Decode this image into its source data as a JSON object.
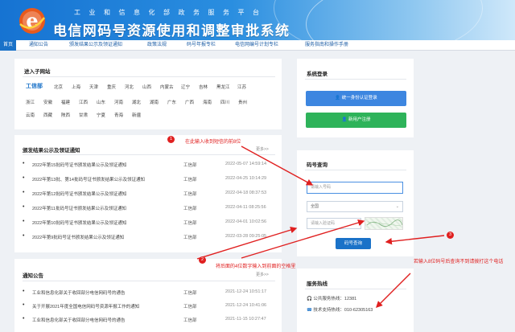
{
  "header": {
    "ministry": "工业和信息化部政务服务平台",
    "system_title": "电信网码号资源使用和调整审批系统"
  },
  "nav": [
    "首页",
    "通知公告",
    "颁发结果公示及领证通知",
    "政策法规",
    "码号年报专栏",
    "电信网编号计划专栏",
    "服务指南和操作手册"
  ],
  "subsites": {
    "title": "进入子网站",
    "items": [
      "工信部",
      "北京",
      "上海",
      "天津",
      "重庆",
      "河北",
      "山西",
      "内蒙古",
      "辽宁",
      "吉林",
      "黑龙江",
      "江苏",
      "浙江",
      "安徽",
      "福建",
      "江西",
      "山东",
      "河南",
      "湖北",
      "湖南",
      "广东",
      "广西",
      "海南",
      "四川",
      "贵州",
      "云南",
      "西藏",
      "陕西",
      "甘肃",
      "宁夏",
      "青海",
      "新疆"
    ]
  },
  "results": {
    "title": "颁发结果公示及领证通知",
    "more": "更多>>",
    "rows": [
      {
        "title": "2022年第15批码号证书颁发结果公示及领证通知",
        "src": "工信部",
        "date": "2022-05-07 14:59:14"
      },
      {
        "title": "2022年第13批、第14批码号证书颁发结果公示及领证通知",
        "src": "工信部",
        "date": "2022-04-25 10:14:29"
      },
      {
        "title": "2022年第12批码号证书颁发结果公示及领证通知",
        "src": "工信部",
        "date": "2022-04-18 08:37:53"
      },
      {
        "title": "2022年第11批码号证书颁发结果公示及领证通知",
        "src": "工信部",
        "date": "2022-04-11 08:25:56"
      },
      {
        "title": "2022年第10批码号证书颁发结果公示及领证通知",
        "src": "工信部",
        "date": "2022-04-01 10:02:56"
      },
      {
        "title": "2022年第9批码号证书颁发结果公示及领证通知",
        "src": "工信部",
        "date": "2022-03-28 09:25:05"
      }
    ]
  },
  "notices": {
    "title": "通知公告",
    "more": "更多>>",
    "rows": [
      {
        "title": "工业和信息化部关于收回部分电信网码号的通告",
        "src": "工信部",
        "date": "2021-12-24 10:51:17"
      },
      {
        "title": "关于开展2021年度全国电信网码号资源年报工作的通知",
        "src": "工信部",
        "date": "2021-12-24 10:41:06"
      },
      {
        "title": "工业和信息化部关于收回部分电信网码号的通告",
        "src": "工信部",
        "date": "2021-11-15 10:27:47"
      }
    ]
  },
  "login": {
    "title": "系统登录",
    "unified_login": "统一身份认证登录",
    "new_user_register": "新用户注册"
  },
  "query": {
    "title": "码号查询",
    "number_placeholder": "请输入号码",
    "region_value": "全国",
    "captcha_placeholder": "请输入验证码",
    "submit": "码号查询"
  },
  "hotline": {
    "title": "服务热线",
    "public_line": "公共服务热线：12381",
    "tech_line": "技术支持热线：010-62305163"
  },
  "annotations": {
    "a1": "在此输入收到短信的前8位",
    "a2": "将后面的4位数字输入到前面的空格里",
    "a3": "若输入8位码号后查询不到请拨打这个电话",
    "n1": "1",
    "n2": "2",
    "n3": "3"
  },
  "colors": {
    "brand_blue": "#1a72c8",
    "login_blue": "#3d86e0",
    "register_green": "#2eb35a",
    "annotation_red": "#e02020"
  }
}
